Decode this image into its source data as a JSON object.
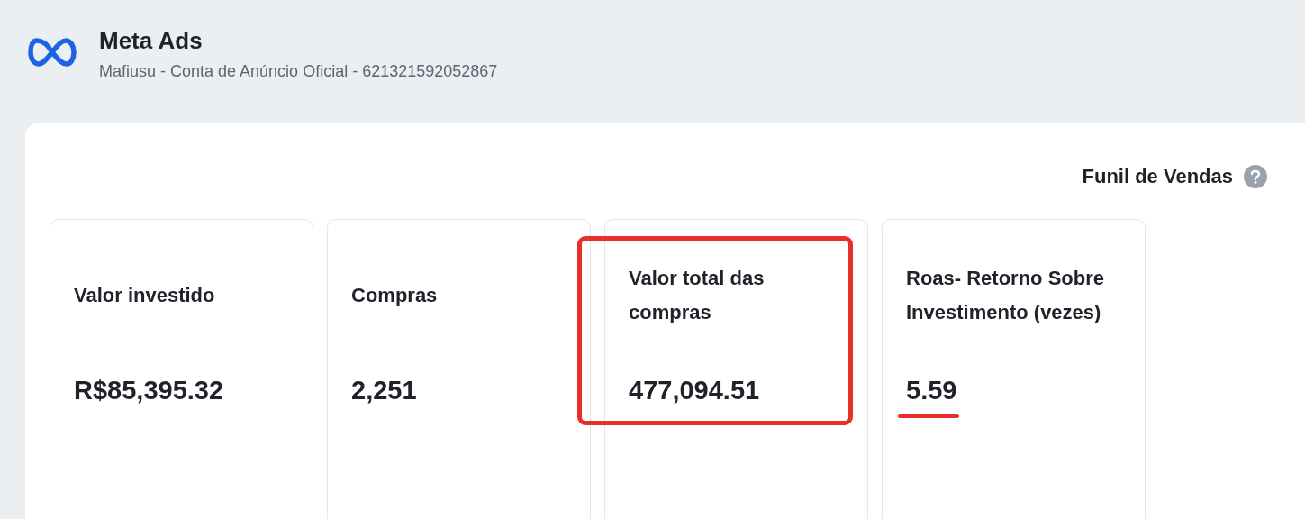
{
  "header": {
    "title": "Meta Ads",
    "subtitle": "Mafiusu - Conta de Anúncio Oficial - 621321592052867"
  },
  "panel": {
    "title": "Funil de Vendas"
  },
  "cards": [
    {
      "label": "Valor investido",
      "value": "R$85,395.32",
      "boxed": false,
      "underlined": false
    },
    {
      "label": "Compras",
      "value": "2,251",
      "boxed": false,
      "underlined": false
    },
    {
      "label": "Valor total das compras",
      "value": "477,094.51",
      "boxed": true,
      "underlined": false
    },
    {
      "label": "Roas- Retorno Sobre Investimento (vezes)",
      "value": "5.59",
      "boxed": false,
      "underlined": true
    }
  ]
}
